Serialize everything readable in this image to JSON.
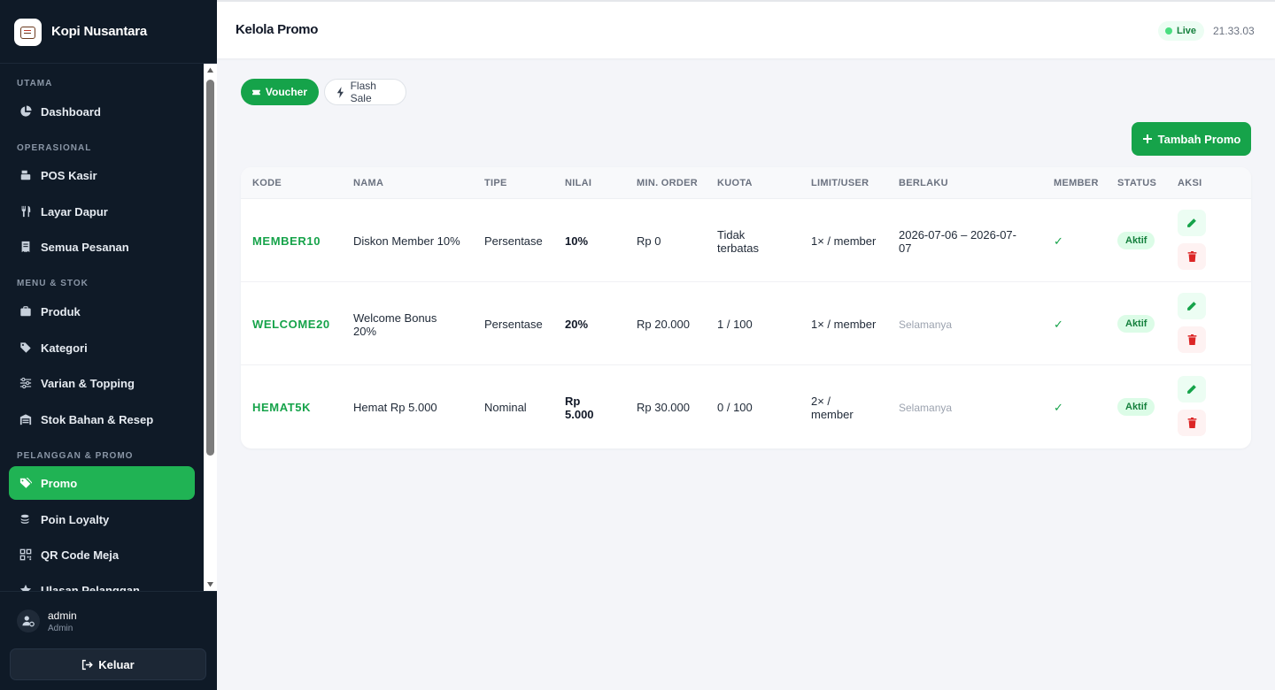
{
  "brand": {
    "name": "Kopi Nusantara"
  },
  "sidebar": {
    "sections": {
      "utama": "UTAMA",
      "operasional": "OPERASIONAL",
      "menu_stok": "MENU & STOK",
      "pelanggan": "PELANGGAN & PROMO"
    },
    "items": [
      {
        "label": "Dashboard",
        "icon": "pie-chart-icon"
      },
      {
        "label": "POS Kasir",
        "icon": "cash-register-icon"
      },
      {
        "label": "Layar Dapur",
        "icon": "utensils-icon"
      },
      {
        "label": "Semua Pesanan",
        "icon": "receipt-icon"
      },
      {
        "label": "Produk",
        "icon": "box-icon"
      },
      {
        "label": "Kategori",
        "icon": "tag-icon"
      },
      {
        "label": "Varian & Topping",
        "icon": "sliders-icon"
      },
      {
        "label": "Stok Bahan & Resep",
        "icon": "warehouse-icon"
      },
      {
        "label": "Promo",
        "icon": "tags-icon"
      },
      {
        "label": "Poin Loyalty",
        "icon": "coins-icon"
      },
      {
        "label": "QR Code Meja",
        "icon": "qrcode-icon"
      },
      {
        "label": "Ulasan Pelanggan",
        "icon": "star-icon"
      }
    ]
  },
  "user": {
    "name": "admin",
    "role": "Admin",
    "logout_label": "Keluar"
  },
  "header": {
    "title": "Kelola Promo",
    "live_label": "Live",
    "clock": "21.33.03"
  },
  "tabs": {
    "voucher": "Voucher",
    "flash_sale": "Flash Sale"
  },
  "add_button": "Tambah Promo",
  "table": {
    "columns": [
      "KODE",
      "NAMA",
      "TIPE",
      "NILAI",
      "MIN. ORDER",
      "KUOTA",
      "LIMIT/USER",
      "BERLAKU",
      "MEMBER",
      "STATUS",
      "AKSI"
    ],
    "rows": [
      {
        "kode": "MEMBER10",
        "nama": "Diskon Member 10%",
        "tipe": "Persentase",
        "nilai": "10%",
        "min_order": "Rp 0",
        "kuota": "Tidak terbatas",
        "limit": "1× / member",
        "berlaku": "2026-07-06 – 2026-07-07",
        "member": "✓",
        "status": "Aktif"
      },
      {
        "kode": "WELCOME20",
        "nama": "Welcome Bonus 20%",
        "tipe": "Persentase",
        "nilai": "20%",
        "min_order": "Rp 20.000",
        "kuota": "1 / 100",
        "limit": "1× / member",
        "berlaku": "Selamanya",
        "member": "✓",
        "status": "Aktif"
      },
      {
        "kode": "HEMAT5K",
        "nama": "Hemat Rp 5.000",
        "tipe": "Nominal",
        "nilai": "Rp 5.000",
        "min_order": "Rp 30.000",
        "kuota": "0 / 100",
        "limit": "2× / member",
        "berlaku": "Selamanya",
        "member": "✓",
        "status": "Aktif"
      }
    ]
  },
  "colors": {
    "accent": "#16a34a",
    "sidebar_bg": "#0f1a27",
    "active_item": "#20b354",
    "danger": "#dc2626"
  }
}
